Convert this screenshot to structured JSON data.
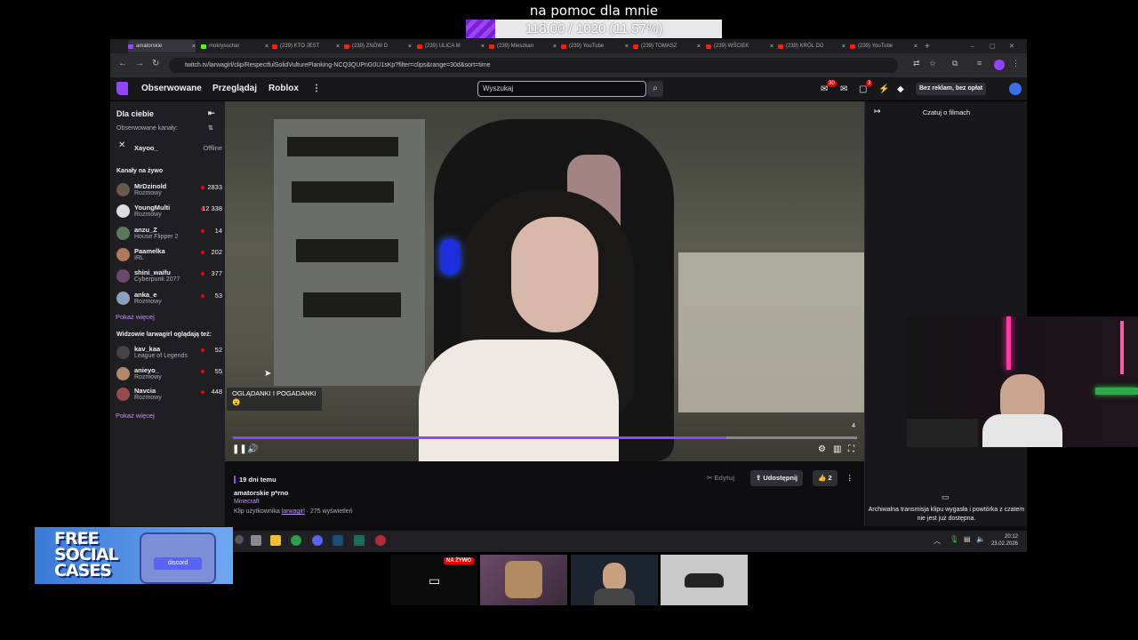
{
  "overlay": {
    "goal_title": "na pomoc dla mnie",
    "goal_text": "118.00 / 1020 (11.57%)",
    "goal_fraction": 0.1157
  },
  "browser": {
    "tabs": [
      {
        "label": "amatorskie",
        "type": "tw"
      },
      {
        "label": "mokrysuchar",
        "type": "kick"
      },
      {
        "label": "(239) KTO JEST",
        "type": "yt"
      },
      {
        "label": "(239) ZNÓW D",
        "type": "yt"
      },
      {
        "label": "(239) ULICA M",
        "type": "yt"
      },
      {
        "label": "(239) Mieszkan",
        "type": "yt"
      },
      {
        "label": "(239) YouTube",
        "type": "yt"
      },
      {
        "label": "(239) TOMASZ",
        "type": "yt"
      },
      {
        "label": "(239) WŚCIEK",
        "type": "yt"
      },
      {
        "label": "(239) KRÓL DO",
        "type": "yt"
      },
      {
        "label": "(239) YouTube",
        "type": "yt"
      }
    ],
    "url": "twitch.tv/larwagirl/clip/RespectfulSolidVulturePlanking-NCQ3QUPnG0U1sKp?filter=clips&range=30d&sort=time"
  },
  "topnav": {
    "followed": "Obserwowane",
    "browse": "Przeglądaj",
    "roblox": "Roblox",
    "search_placeholder": "Wyszukaj",
    "inbox_count": "30",
    "whispers_count": "3",
    "ad_free": "Bez reklam, bez opłat"
  },
  "sidebar": {
    "for_you": "Dla ciebie",
    "followed_channels": "Obserwowane kanały:",
    "offline_channel": {
      "name": "Xayoo_",
      "status": "Offline"
    },
    "live_channels": "Kanały na żywo",
    "channels": [
      {
        "name": "MrDzinold",
        "game": "Rozmowy",
        "viewers": "2833"
      },
      {
        "name": "YoungMulti",
        "game": "Rozmowy",
        "viewers": "12 338"
      },
      {
        "name": "anzu_Z",
        "game": "House Flipper 2",
        "viewers": "14"
      },
      {
        "name": "Paamelka",
        "game": "IRL",
        "viewers": "202"
      },
      {
        "name": "shini_waifu",
        "game": "Cyberpunk 2077",
        "viewers": "377"
      },
      {
        "name": "anka_e",
        "game": "Rozmowy",
        "viewers": "53"
      }
    ],
    "show_more_1": "Pokaż więcej",
    "viewers_also_watch": "Widzowie larwagirl oglądają też:",
    "related": [
      {
        "name": "kav_kaa",
        "game": "League of Legends",
        "viewers": "52"
      },
      {
        "name": "anieyo_",
        "game": "Rozmowy",
        "viewers": "55"
      },
      {
        "name": "Navcia",
        "game": "Rozmowy",
        "viewers": "448"
      }
    ],
    "show_more_2": "Pokaż więcej"
  },
  "player": {
    "chip_title": "OGLĄDANKI I POGADANKI",
    "chip_emoji": "😮",
    "counter": "4",
    "progress_fraction": 0.79
  },
  "clip": {
    "ago": "19 dni temu",
    "title": "amatorskie p*rno",
    "game": "Minecraft",
    "by_prefix": "Klip użytkownika",
    "author": "larwagirl",
    "views": "· 275 wyświetleń",
    "edit": "Edytuj",
    "share": "Udostępnij",
    "likes": "2"
  },
  "chat": {
    "title": "Czatuj o filmach",
    "archived_msg": "Archiwalna transmisja klipu wygasła i powtórka z czatem nie jest już dostępna."
  },
  "taskbar": {
    "time": "20:12",
    "date": "23.02.2026"
  },
  "social": {
    "text": "FREE SOCIAL CASES",
    "box_label": "discord"
  },
  "cards": {
    "live_badge": "NA ŻYWO"
  }
}
